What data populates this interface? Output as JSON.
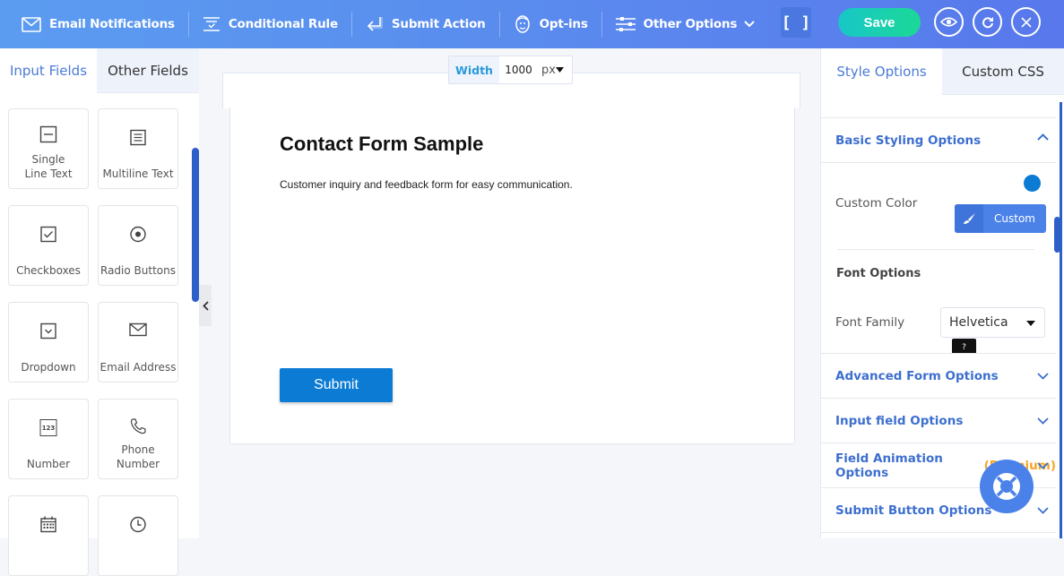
{
  "topbar": {
    "items": [
      {
        "label": "Email Notifications",
        "icon": "mail-icon"
      },
      {
        "label": "Conditional Rule",
        "icon": "conditional-icon"
      },
      {
        "label": "Submit Action",
        "icon": "enter-arrow-icon"
      },
      {
        "label": "Opt-ins",
        "icon": "mailchimp-icon"
      },
      {
        "label": "Other Options",
        "icon": "sliders-icon"
      }
    ],
    "fullscreen_label": "[ ]",
    "save_label": "Save"
  },
  "left_panel": {
    "tabs": [
      "Input Fields",
      "Other Fields"
    ],
    "active_tab": "Input Fields",
    "fields": [
      {
        "label": "Single Line Text",
        "icon": "single-line-icon"
      },
      {
        "label": "Multiline Text",
        "icon": "multiline-icon"
      },
      {
        "label": "Checkboxes",
        "icon": "checkbox-icon"
      },
      {
        "label": "Radio Buttons",
        "icon": "radio-icon"
      },
      {
        "label": "Dropdown",
        "icon": "dropdown-icon"
      },
      {
        "label": "Email Address",
        "icon": "email-icon"
      },
      {
        "label": "Number",
        "icon": "number-icon"
      },
      {
        "label": "Phone Number",
        "icon": "phone-icon"
      },
      {
        "label": "",
        "icon": "calendar-icon"
      },
      {
        "label": "",
        "icon": "clock-icon"
      }
    ],
    "number_glyph": "123"
  },
  "canvas": {
    "width_label": "Width",
    "width_value": "1000",
    "width_unit": "px",
    "form_title": "Contact Form Sample",
    "form_description": "Customer inquiry and feedback form for easy communication.",
    "submit_label": "Submit"
  },
  "right_panel": {
    "tabs": [
      "Style Options",
      "Custom CSS"
    ],
    "active_tab": "Style Options",
    "basic_styling": {
      "title": "Basic Styling Options",
      "custom_color_label": "Custom Color",
      "custom_color_value": "#0b7bd4",
      "custom_button_label": "Custom",
      "font_options_title": "Font Options",
      "font_family_label": "Font Family",
      "font_family_value": "Helvetica",
      "tooltip_glyph": "?"
    },
    "sections": [
      {
        "title": "Advanced Form Options",
        "badge": ""
      },
      {
        "title": "Input field Options",
        "badge": ""
      },
      {
        "title": "Field Animation Options",
        "badge": "(Premium)"
      },
      {
        "title": "Submit Button Options",
        "badge": ""
      }
    ]
  },
  "colors": {
    "accent": "#4c7ad6",
    "submit": "#0b7bd4",
    "save_gradient_start": "#18c6c8",
    "save_gradient_end": "#1bd996",
    "premium": "#f5a623"
  }
}
